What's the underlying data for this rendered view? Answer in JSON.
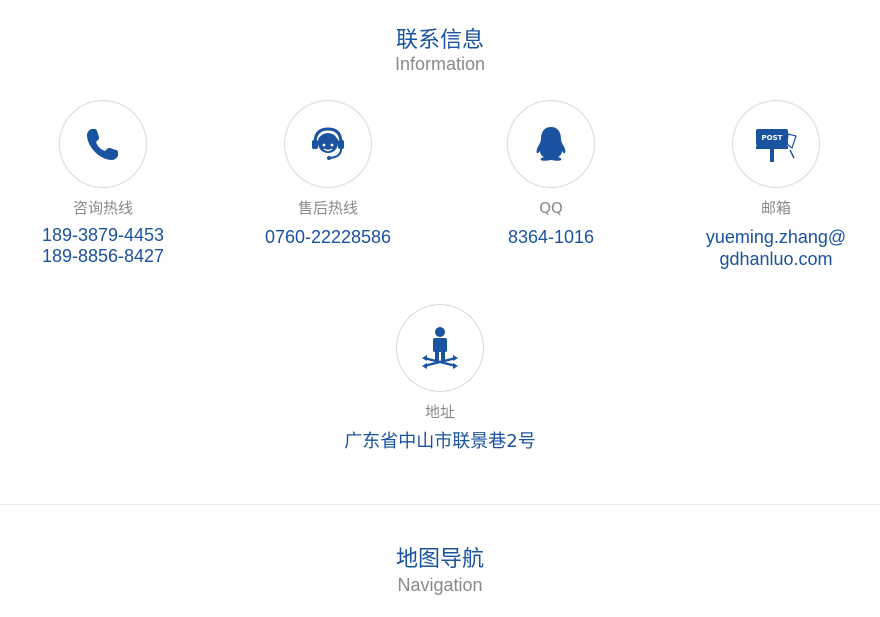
{
  "contact_section": {
    "title_cn": "联系信息",
    "title_en": "Information"
  },
  "items": {
    "consult": {
      "icon": "phone-icon",
      "label": "咨询热线",
      "lines": [
        "189-3879-4453",
        "189-8856-8427"
      ]
    },
    "after_sales": {
      "icon": "headset-icon",
      "label": "售后热线",
      "lines": [
        "0760-22228586"
      ]
    },
    "qq": {
      "icon": "qq-penguin-icon",
      "label": "QQ",
      "lines": [
        "8364-1016"
      ]
    },
    "email": {
      "icon": "post-mailbox-icon",
      "label": "邮箱",
      "lines": [
        "yueming.zhang@",
        "gdhanluo.com"
      ]
    },
    "address": {
      "icon": "location-person-icon",
      "label": "地址",
      "lines": [
        "广东省中山市联景巷2号"
      ]
    }
  },
  "map_section": {
    "title_cn": "地图导航",
    "title_en": "Navigation"
  },
  "colors": {
    "accent": "#1a53a0",
    "label_gray": "#8a8a8a",
    "circle_border": "#d9d9d9"
  }
}
